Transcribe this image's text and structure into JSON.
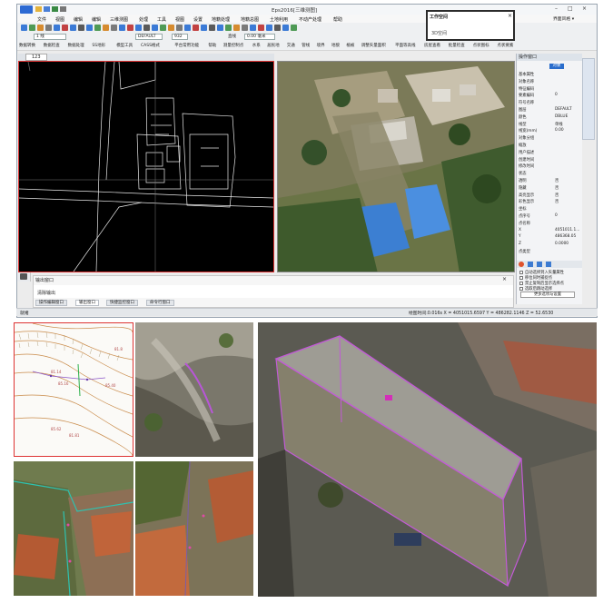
{
  "app": {
    "title": "Eps2016[三维测图]",
    "workspace_popup": {
      "title": "工作空间",
      "item": "3D空间"
    },
    "top_right_link": "界面风格 ▾",
    "menu": [
      "文件",
      "视图",
      "编辑",
      "编辑",
      "三维测图",
      "处理",
      "工具",
      "视图",
      "设置",
      "地籍处理",
      "地籍总图",
      "土地利用",
      "不动产处理",
      "帮助"
    ],
    "toolbar1": {
      "scale_value": "932",
      "layer_value": "1 线",
      "default_value": "DEFAULT",
      "line_label": "直线",
      "color_value": "0.00 毫米"
    },
    "toolbar3": [
      "数据转换",
      "数据检查",
      "数据处理",
      "SS地形",
      "模型工具",
      "CASS格式",
      "平台常用功能",
      "帮助",
      "测量控制点",
      "水系",
      "居民地",
      "交通",
      "管线",
      "境界",
      "地貌",
      "植被",
      "调整矢量面积",
      "平面等高线",
      "房屋查看",
      "批量检查",
      "点状图标",
      "点状要素"
    ],
    "cad_tab": "123",
    "output": {
      "title": "输出窗口",
      "line": "清除输出",
      "tabs": [
        "操作编辑窗口",
        "输出窗口",
        "快捷监控窗口",
        "命令行窗口"
      ]
    },
    "status": {
      "left": "就绪",
      "coords": "绘图时间:0.016s  X = 4051015.6597  Y = 486282.1146  Z = 52.6530"
    },
    "properties": {
      "title": "操作窗口",
      "tab": "对象",
      "rows": [
        {
          "label": "基本属性",
          "value": ""
        },
        {
          "label": "对象名称",
          "value": ""
        },
        {
          "label": "特征编码",
          "value": ""
        },
        {
          "label": "要素编码",
          "value": "0"
        },
        {
          "label": "符号名称",
          "value": ""
        },
        {
          "label": "图层",
          "value": "DEFAULT"
        },
        {
          "label": "颜色",
          "value": "DBLUE"
        },
        {
          "label": "线型",
          "value": "单线"
        },
        {
          "label": "线宽(mm)",
          "value": "0.00"
        },
        {
          "label": "对象分组",
          "value": ""
        },
        {
          "label": "缩放",
          "value": ""
        },
        {
          "label": "用户描述",
          "value": ""
        },
        {
          "label": "创建时间",
          "value": ""
        },
        {
          "label": "修改时间",
          "value": ""
        },
        {
          "label": "状态",
          "value": ""
        },
        {
          "label": "透明",
          "value": "否"
        },
        {
          "label": "隐藏",
          "value": "否"
        },
        {
          "label": "高亮显示",
          "value": "否"
        },
        {
          "label": "彩色显示",
          "value": "否"
        },
        {
          "label": "坐标",
          "value": ""
        },
        {
          "label": "点序号",
          "value": "0"
        },
        {
          "label": "点名称",
          "value": ""
        },
        {
          "label": "X",
          "value": "4051011.1..."
        },
        {
          "label": "Y",
          "value": "486368.05"
        },
        {
          "label": "Z",
          "value": "0.0000"
        },
        {
          "label": "点类型",
          "value": ""
        }
      ],
      "checks": [
        "自动选择到入矢量属性",
        "移位同时捕捉点",
        "禁止复制后显示选择点",
        "选取后跳动选择"
      ],
      "button": "更多选项与设置"
    }
  },
  "colors": {
    "cad_border": "#dd3333",
    "accent_blue": "#2a6dcc",
    "terrain_line": "#cc7a3a",
    "magenta": "#b055c8"
  },
  "panels": {
    "contour_labels": [
      "81.8",
      "81.14",
      "85.16",
      "85.40",
      "85.62",
      "81.81"
    ]
  }
}
